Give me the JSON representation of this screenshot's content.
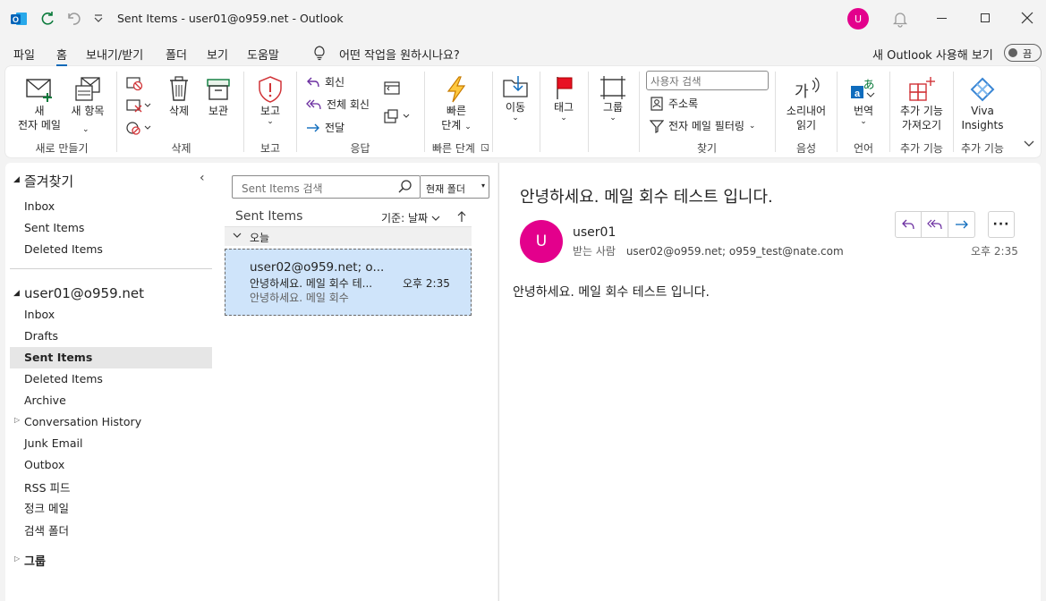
{
  "titlebar": {
    "title": "Sent Items - user01@o959.net  -  Outlook",
    "avatar_initial": "U"
  },
  "menu": {
    "items": [
      "파일",
      "홈",
      "보내기/받기",
      "폴더",
      "보기",
      "도움말"
    ],
    "tell_me": "어떤 작업을 원하시나요?",
    "new_outlook_label": "새 Outlook 사용해 보기",
    "toggle_label": "끔"
  },
  "ribbon": {
    "new_mail_1": "새",
    "new_mail_2": "전자 메일",
    "new_items_1": "새 항목",
    "group_new": "새로 만들기",
    "delete_label": "삭제",
    "archive_label": "보관",
    "group_delete": "삭제",
    "report_label": "보고",
    "group_report": "보고",
    "reply": "회신",
    "reply_all": "전체 회신",
    "forward": "전달",
    "group_respond": "응답",
    "quick_steps_1": "빠른",
    "quick_steps_2": "단계",
    "group_quick_steps": "빠른 단계",
    "move_label": "이동",
    "tags_label": "태그",
    "groups_label": "그룹",
    "people_search_placeholder": "사용자 검색",
    "address_book": "주소록",
    "filter_email": "전자 메일 필터링",
    "group_find": "찾기",
    "read_aloud_1": "소리내어",
    "read_aloud_2": "읽기",
    "group_speech": "음성",
    "translate_label": "번역",
    "group_language": "언어",
    "addins_1": "추가 기능",
    "addins_2": "가져오기",
    "group_addins_1": "추가 기능",
    "viva_1": "Viva",
    "viva_2": "Insights",
    "group_addins_2": "추가 기능"
  },
  "folders": {
    "favorites_title": "즐겨찾기",
    "favorites": [
      "Inbox",
      "Sent Items",
      "Deleted Items"
    ],
    "account": "user01@o959.net",
    "account_folders": [
      "Inbox",
      "Drafts",
      "Sent Items",
      "Deleted Items",
      "Archive",
      "Conversation History",
      "Junk Email",
      "Outbox",
      "RSS 피드",
      "정크 메일",
      "검색 폴더"
    ],
    "groups_label": "그룹"
  },
  "list": {
    "search_placeholder": "Sent Items 검색",
    "scope": "현재 폴더",
    "folder_title": "Sent Items",
    "sort_label": "기준: 날짜",
    "date_group": "오늘",
    "message": {
      "to": "user02@o959.net; o...",
      "subject": "안녕하세요. 메일 회수 테...",
      "time": "오후 2:35",
      "preview": "안녕하세요. 메일 회수"
    }
  },
  "reading": {
    "subject": "안녕하세요. 메일 회수 테스트 입니다.",
    "avatar_initial": "U",
    "sender": "user01",
    "to_label": "받는 사람",
    "recipients": "user02@o959.net; o959_test@nate.com",
    "time": "오후 2:35",
    "body": "안녕하세요. 메일 회수 테스트 입니다."
  },
  "colors": {
    "accent": "#0f6cbd",
    "avatar": "#e3008c",
    "selected_mail": "#cfe4fa",
    "report_red": "#d13438"
  }
}
